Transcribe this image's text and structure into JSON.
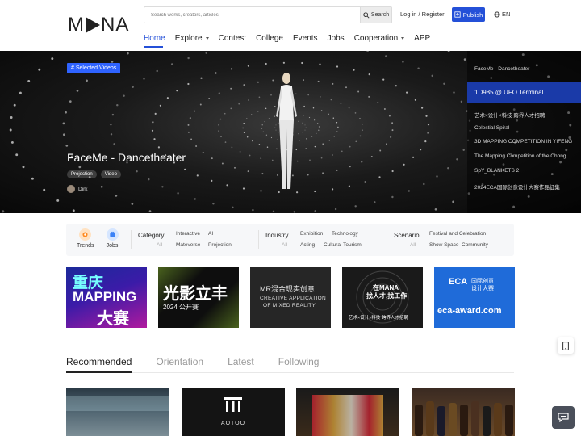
{
  "header": {
    "logo": "MNA",
    "search_placeholder": "Search works, creators, articles",
    "search_button": "Search",
    "login": "Log in / Register",
    "publish": "Publish",
    "language": "EN"
  },
  "nav": [
    {
      "label": "Home",
      "active": true
    },
    {
      "label": "Explore",
      "dropdown": true
    },
    {
      "label": "Contest"
    },
    {
      "label": "College"
    },
    {
      "label": "Events"
    },
    {
      "label": "Jobs"
    },
    {
      "label": "Cooperation",
      "dropdown": true
    },
    {
      "label": "APP"
    }
  ],
  "hero": {
    "tag": "# Selected Videos",
    "title": "FaceMe - Dancetheater",
    "chips": [
      "Projection",
      "Video"
    ],
    "author": "Dirk",
    "list": [
      "FaceMe - Dancetheater",
      "1D985 @ UFO Terminal",
      "艺术×设计×科技 跨界人才招聘",
      "Celestial Spiral",
      "3D MAPPING COMPETITION IN YIFENG",
      "The Mapping Competition of the Chong...",
      "SpY_BLANKETS 2",
      "2024ECA国际创意设计大赛作品征集"
    ],
    "current_index": 1
  },
  "categories": {
    "trends": "Trends",
    "jobs": "Jobs",
    "groups": [
      {
        "head": "Category",
        "all": "All",
        "options": [
          "Interactive",
          "AI",
          "Mateverse",
          "Projection"
        ]
      },
      {
        "head": "Industry",
        "all": "All",
        "options": [
          "Exhibition",
          "Technology",
          "Acting",
          "Cultural Tourism"
        ]
      },
      {
        "head": "Scenario",
        "all": "All",
        "options": [
          "Festival and Celebration",
          "Show Space",
          "Community"
        ]
      }
    ]
  },
  "banners": {
    "b1": {
      "line1": "重庆",
      "line2": "MAPPING",
      "line3": "大赛"
    },
    "b2": {
      "line1": "光影立丰",
      "line2": "2024 公开赛"
    },
    "b3": {
      "line1": "MR混合现实创意",
      "line2": "CREATIVE APPLICATION",
      "line3": "OF MIXED REALITY"
    },
    "b4": {
      "line1": "在MANA",
      "line2": "找人才,找工作",
      "line3": "艺术×设计×科技 跨界人才招聘"
    },
    "b5": {
      "line1": "ECA",
      "line2": "国际创意",
      "line3": "设计大赛",
      "line4": "eca-award.com"
    }
  },
  "tabs": [
    "Recommended",
    "Orientation",
    "Latest",
    "Following"
  ],
  "cards": {
    "c2_label": "AOTOO"
  },
  "colors": {
    "accent": "#2450d8",
    "tag_blue": "#2f63ff",
    "hero_current": "#1a3aa8"
  }
}
